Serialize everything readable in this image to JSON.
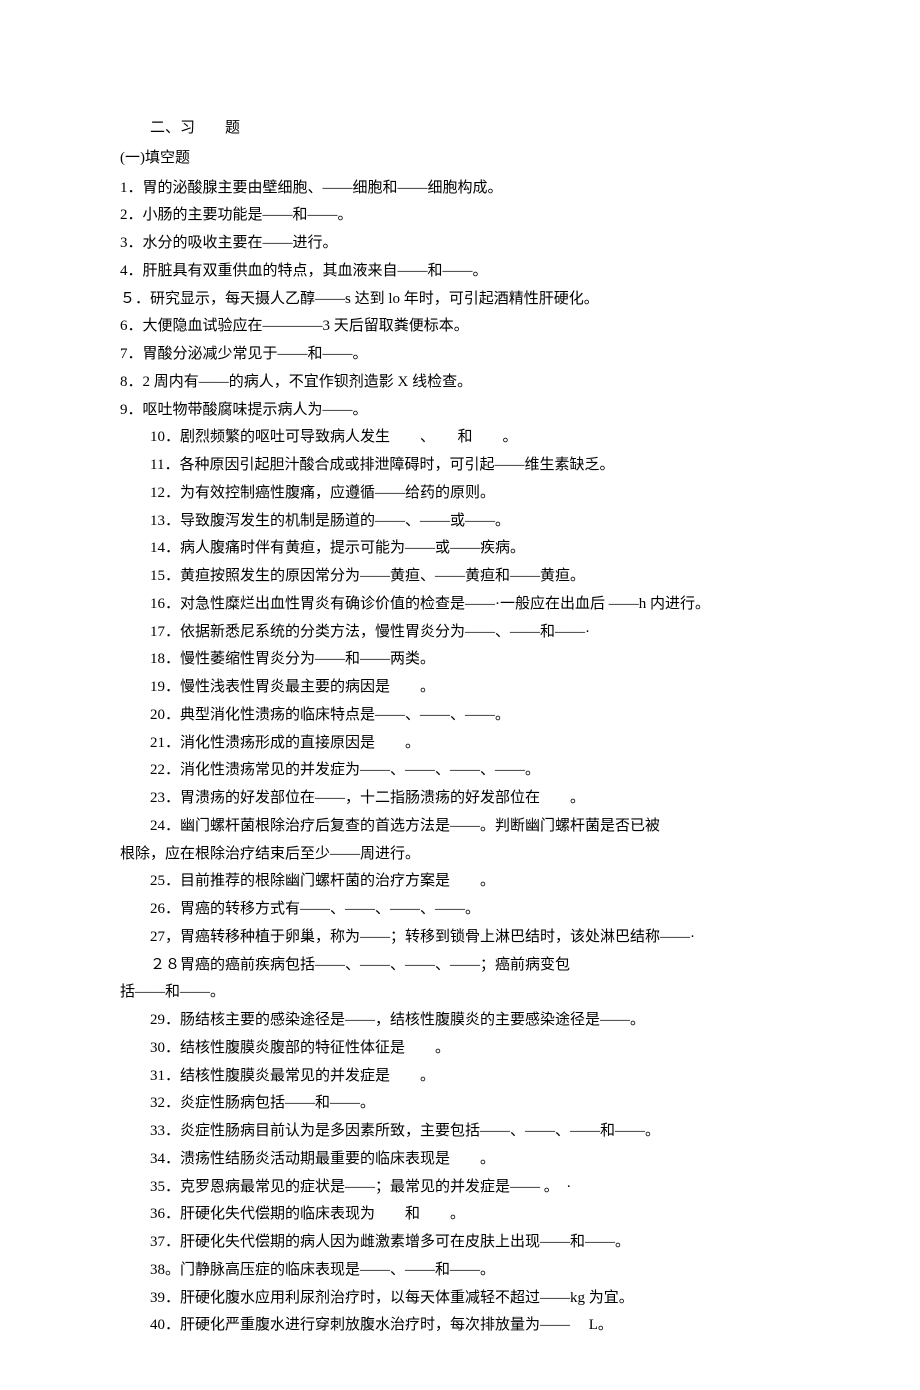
{
  "section_title": "二、习　　题",
  "subsection_title": "(一)填空题",
  "items": [
    {
      "text": "1．胃的泌酸腺主要由壁细胞、——细胞和——细胞构成。",
      "indent": "indent1"
    },
    {
      "text": "2．小肠的主要功能是——和——。",
      "indent": "indent1"
    },
    {
      "text": "3．水分的吸收主要在——进行。",
      "indent": "indent1"
    },
    {
      "text": "4．肝脏具有双重供血的特点，其血液来自——和——。",
      "indent": "indent1"
    },
    {
      "text": "５．研究显示，每天摄人乙醇——s 达到 lo 年时，可引起酒精性肝硬化。",
      "indent": "indent1"
    },
    {
      "text": "6．大便隐血试验应在————3 天后留取粪便标本。",
      "indent": "indent1"
    },
    {
      "text": "7．胃酸分泌减少常见于——和——。",
      "indent": "indent1"
    },
    {
      "text": "8．2 周内有——的病人，不宜作钡剂造影 X 线检查。",
      "indent": "indent1"
    },
    {
      "text": "9．呕吐物带酸腐味提示病人为——。",
      "indent": "indent1"
    },
    {
      "text": "10．剧烈频繁的呕吐可导致病人发生　　、　　和　　。",
      "indent": "indent2"
    },
    {
      "text": "11．各种原因引起胆汁酸合成或排泄障碍时，可引起——维生素缺乏。",
      "indent": "indent2"
    },
    {
      "text": "12．为有效控制癌性腹痛，应遵循——给药的原则。",
      "indent": "indent2"
    },
    {
      "text": "13．导致腹泻发生的机制是肠道的——、——或——。",
      "indent": "indent2"
    },
    {
      "text": "14．病人腹痛时伴有黄疸，提示可能为——或——疾病。",
      "indent": "indent2"
    },
    {
      "text": "15．黄疸按照发生的原因常分为——黄疸、——黄疸和——黄疸。",
      "indent": "indent2"
    },
    {
      "text": "16．对急性糜烂出血性胃炎有确诊价值的检查是——·一般应在出血后  ——h 内进行。",
      "indent": "indent2"
    },
    {
      "text": "17．依据新悉尼系统的分类方法，慢性胃炎分为——、——和——·",
      "indent": "indent2"
    },
    {
      "text": "18．慢性萎缩性胃炎分为——和——两类。",
      "indent": "indent2"
    },
    {
      "text": "19．慢性浅表性胃炎最主要的病因是　　。",
      "indent": "indent2"
    },
    {
      "text": "20．典型消化性溃疡的临床特点是——、——、——。",
      "indent": "indent2"
    },
    {
      "text": "21．消化性溃疡形成的直接原因是　　。",
      "indent": "indent2"
    },
    {
      "text": "22．消化性溃疡常见的并发症为——、——、——、——。",
      "indent": "indent2"
    },
    {
      "text": "23．胃溃疡的好发部位在——，十二指肠溃疡的好发部位在　　。",
      "indent": "indent2"
    },
    {
      "text": "24．幽门螺杆菌根除治疗后复查的首选方法是——。判断幽门螺杆菌是否已被",
      "indent": "indent2"
    },
    {
      "text": "根除，应在根除治疗结束后至少——周进行。",
      "indent": "hanging"
    },
    {
      "text": "25．目前推荐的根除幽门螺杆菌的治疗方案是　　。",
      "indent": "indent2"
    },
    {
      "text": "26．胃癌的转移方式有——、——、——、——。",
      "indent": "indent2"
    },
    {
      "text": "27，胃癌转移种植于卵巢，称为——；转移到锁骨上淋巴结时，该处淋巴结称——·",
      "indent": "indent2"
    },
    {
      "text": "２８胃癌的癌前疾病包括——、——、——、——；癌前病变包",
      "indent": "indent2"
    },
    {
      "text": "括——和——。",
      "indent": "hanging"
    },
    {
      "text": "29．肠结核主要的感染途径是——，结核性腹膜炎的主要感染途径是——。",
      "indent": "indent2"
    },
    {
      "text": "30．结核性腹膜炎腹部的特征性体征是　　。",
      "indent": "indent2"
    },
    {
      "text": "31．结核性腹膜炎最常见的并发症是　　。",
      "indent": "indent2"
    },
    {
      "text": "32．炎症性肠病包括——和——。",
      "indent": "indent2"
    },
    {
      "text": "33．炎症性肠病目前认为是多因素所致，主要包括——、——、——和——。",
      "indent": "indent2"
    },
    {
      "text": "34．溃疡性结肠炎活动期最重要的临床表现是　　。",
      "indent": "indent2"
    },
    {
      "text": "35．克罗恩病最常见的症状是——；最常见的并发症是—— 。　·",
      "indent": "indent2"
    },
    {
      "text": "36．肝硬化失代偿期的临床表现为　　和　　。",
      "indent": "indent2"
    },
    {
      "text": "37．肝硬化失代偿期的病人因为雌激素增多可在皮肤上出现——和——。",
      "indent": "indent2"
    },
    {
      "text": "38。门静脉高压症的临床表现是——、——和——。",
      "indent": "indent2"
    },
    {
      "text": "39．肝硬化腹水应用利尿剂治疗时，以每天体重减轻不超过——kg 为宜。",
      "indent": "indent2"
    },
    {
      "text": "40．肝硬化严重腹水进行穿刺放腹水治疗时，每次排放量为——　  L。",
      "indent": "indent2"
    }
  ]
}
